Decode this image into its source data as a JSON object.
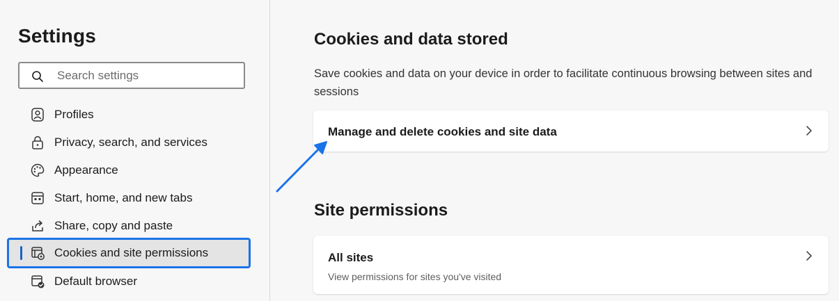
{
  "sidebar": {
    "title": "Settings",
    "search": {
      "placeholder": "Search settings",
      "value": ""
    },
    "items": [
      {
        "label": "Profiles",
        "icon": "profile-icon"
      },
      {
        "label": "Privacy, search, and services",
        "icon": "lock-icon"
      },
      {
        "label": "Appearance",
        "icon": "palette-icon"
      },
      {
        "label": "Start, home, and new tabs",
        "icon": "browser-window-icon"
      },
      {
        "label": "Share, copy and paste",
        "icon": "share-icon"
      },
      {
        "label": "Cookies and site permissions",
        "icon": "cookie-settings-icon",
        "active": true
      },
      {
        "label": "Default browser",
        "icon": "default-browser-icon"
      }
    ]
  },
  "main": {
    "cookies_section": {
      "title": "Cookies and data stored",
      "description": "Save cookies and data on your device in order to facilitate continuous browsing between sites and sessions",
      "manage_card": {
        "label": "Manage and delete cookies and site data"
      }
    },
    "permissions_section": {
      "title": "Site permissions",
      "all_sites_card": {
        "label": "All sites",
        "sublabel": "View permissions for sites you've visited"
      }
    }
  },
  "colors": {
    "accent": "#1a73e8",
    "annotation_arrow": "#1a73e8",
    "background": "#f7f7f7",
    "card": "#ffffff"
  }
}
